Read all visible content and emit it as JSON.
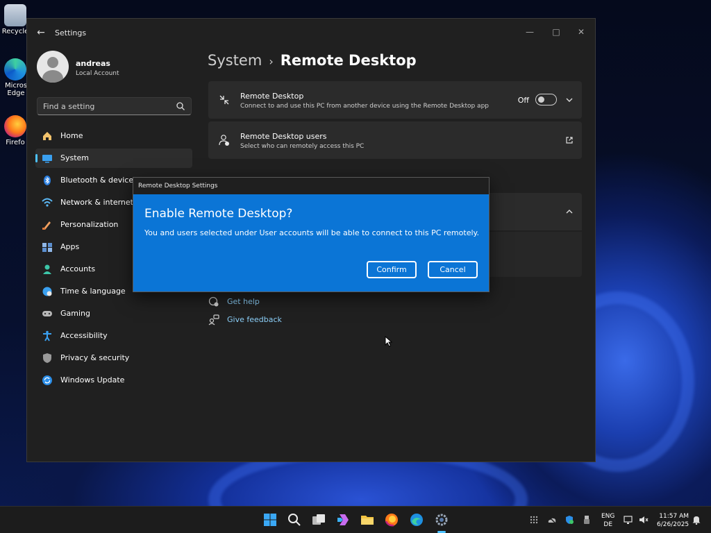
{
  "desktop": {
    "icons": [
      {
        "label": "Recycle"
      },
      {
        "label": "Micros Edge"
      },
      {
        "label": "Firefo"
      }
    ]
  },
  "window": {
    "title": "Settings",
    "profile": {
      "name": "andreas",
      "account_type": "Local Account"
    },
    "search": {
      "placeholder": "Find a setting"
    },
    "nav": [
      {
        "label": "Home",
        "icon": "home-icon"
      },
      {
        "label": "System",
        "icon": "system-icon",
        "active": true
      },
      {
        "label": "Bluetooth & devices",
        "icon": "bluetooth-icon"
      },
      {
        "label": "Network & internet",
        "icon": "wifi-icon"
      },
      {
        "label": "Personalization",
        "icon": "brush-icon"
      },
      {
        "label": "Apps",
        "icon": "apps-icon"
      },
      {
        "label": "Accounts",
        "icon": "person-icon"
      },
      {
        "label": "Time & language",
        "icon": "globe-clock-icon"
      },
      {
        "label": "Gaming",
        "icon": "gamepad-icon"
      },
      {
        "label": "Accessibility",
        "icon": "accessibility-icon"
      },
      {
        "label": "Privacy & security",
        "icon": "shield-icon"
      },
      {
        "label": "Windows Update",
        "icon": "update-icon"
      }
    ],
    "breadcrumb": {
      "parent": "System",
      "separator": "›",
      "current": "Remote Desktop"
    },
    "cards": {
      "remote_desktop": {
        "title": "Remote Desktop",
        "subtitle": "Connect to and use this PC from another device using the Remote Desktop app",
        "toggle_label": "Off",
        "toggle_on": false
      },
      "remote_users": {
        "title": "Remote Desktop users",
        "subtitle": "Select who can remotely access this PC"
      }
    },
    "links": {
      "get_help": "Get help",
      "give_feedback": "Give feedback"
    }
  },
  "dialog": {
    "window_title": "Remote Desktop Settings",
    "heading": "Enable Remote Desktop?",
    "body": "You and users selected under User accounts will be able to connect to this PC remotely.",
    "confirm_label": "Confirm",
    "cancel_label": "Cancel"
  },
  "taskbar": {
    "language": {
      "line1": "ENG",
      "line2": "DE"
    },
    "clock": {
      "time": "11:57 AM",
      "date": "6/26/2025"
    }
  },
  "colors": {
    "accent": "#4cc2ff",
    "dialog_bg": "#0b75d6",
    "window_bg": "#202020",
    "card_bg": "#2b2b2b",
    "link": "#8ccff8"
  }
}
